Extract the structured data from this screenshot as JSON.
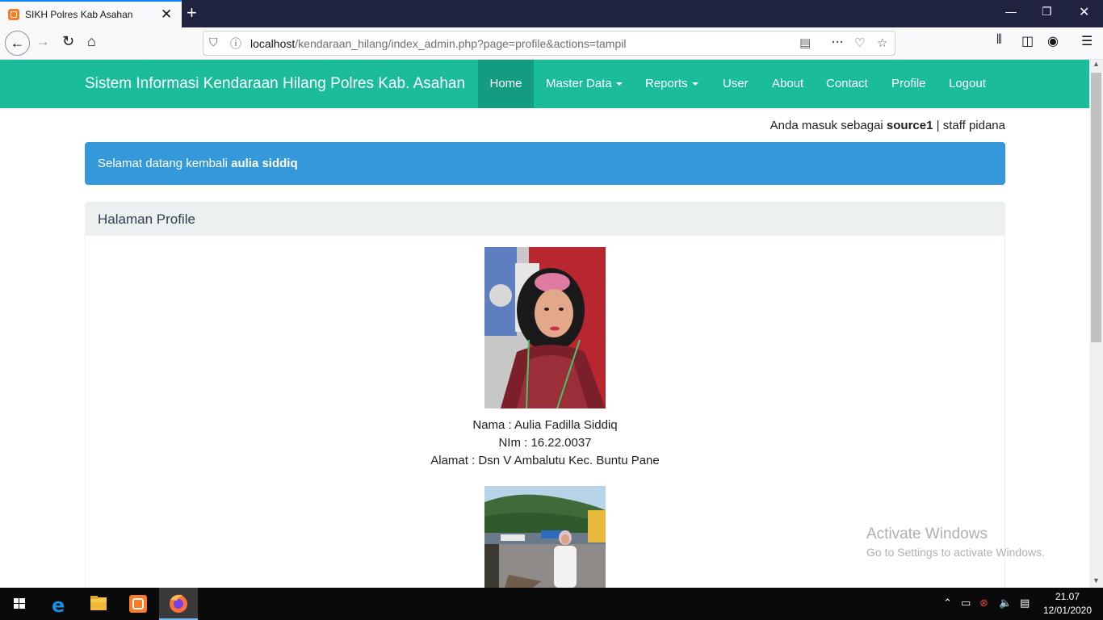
{
  "browser": {
    "tab_title": "SIKH Polres Kab Asahan",
    "url_host": "localhost",
    "url_path": "/kendaraan_hilang/index_admin.php?page=profile&actions=tampil"
  },
  "navbar": {
    "brand": "Sistem Informasi Kendaraan Hilang Polres Kab. Asahan",
    "items": [
      {
        "label": "Home"
      },
      {
        "label": "Master Data"
      },
      {
        "label": "Reports"
      },
      {
        "label": "User"
      },
      {
        "label": "About"
      },
      {
        "label": "Contact"
      },
      {
        "label": "Profile"
      },
      {
        "label": "Logout"
      }
    ]
  },
  "login_info": {
    "prefix": "Anda masuk sebagai ",
    "username": "source1",
    "separator": " | ",
    "role": "staff pidana"
  },
  "alert": {
    "prefix": "Selamat datang kembali ",
    "name": "aulia siddiq"
  },
  "panel": {
    "title": "Halaman Profile",
    "profile": {
      "nama": "Nama : Aulia Fadilla Siddiq",
      "nim": "NIm : 16.22.0037",
      "alamat": "Alamat : Dsn V Ambalutu Kec. Buntu Pane"
    }
  },
  "watermark": {
    "line1": "Activate Windows",
    "line2": "Go to Settings to activate Windows."
  },
  "taskbar": {
    "time": "21.07",
    "date": "12/01/2020"
  },
  "colors": {
    "navbar": "#1abc9c",
    "navbar_active": "#149c82",
    "alert": "#3498db",
    "panel_head": "#ecf0f1"
  }
}
